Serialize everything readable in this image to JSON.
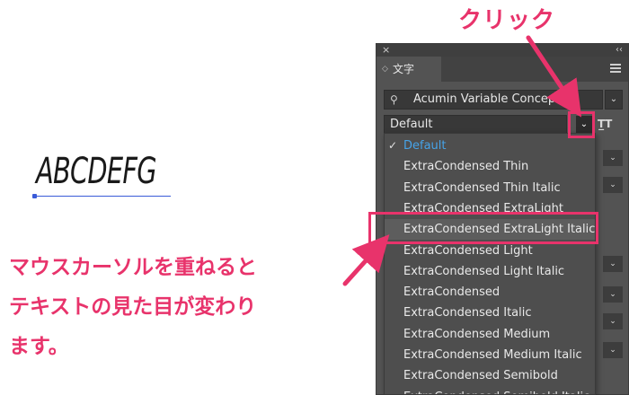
{
  "sample": {
    "text": "ABCDEFG"
  },
  "panel": {
    "close_glyph": "×",
    "collapse_glyph": "‹‹",
    "tab_label": "文字",
    "font_family": "Acumin Variable Concept",
    "font_style": "Default",
    "tt_glyph": "T̲T"
  },
  "dropdown": {
    "items": [
      {
        "label": "Default",
        "checked": true
      },
      {
        "label": "ExtraCondensed Thin"
      },
      {
        "label": "ExtraCondensed Thin Italic"
      },
      {
        "label": "ExtraCondensed ExtraLight"
      },
      {
        "label": "ExtraCondensed ExtraLight Italic",
        "hovered": true
      },
      {
        "label": "ExtraCondensed Light"
      },
      {
        "label": "ExtraCondensed Light Italic"
      },
      {
        "label": "ExtraCondensed"
      },
      {
        "label": "ExtraCondensed Italic"
      },
      {
        "label": "ExtraCondensed Medium"
      },
      {
        "label": "ExtraCondensed Medium Italic"
      },
      {
        "label": "ExtraCondensed Semibold"
      },
      {
        "label": "ExtraCondensed Semibold Italic"
      }
    ]
  },
  "annotations": {
    "click_label": "クリック",
    "note_lines": [
      "マウスカーソルを重ねると",
      "テキストの見た目が変わり",
      "ます。"
    ],
    "accent_color": "#e8336b"
  }
}
